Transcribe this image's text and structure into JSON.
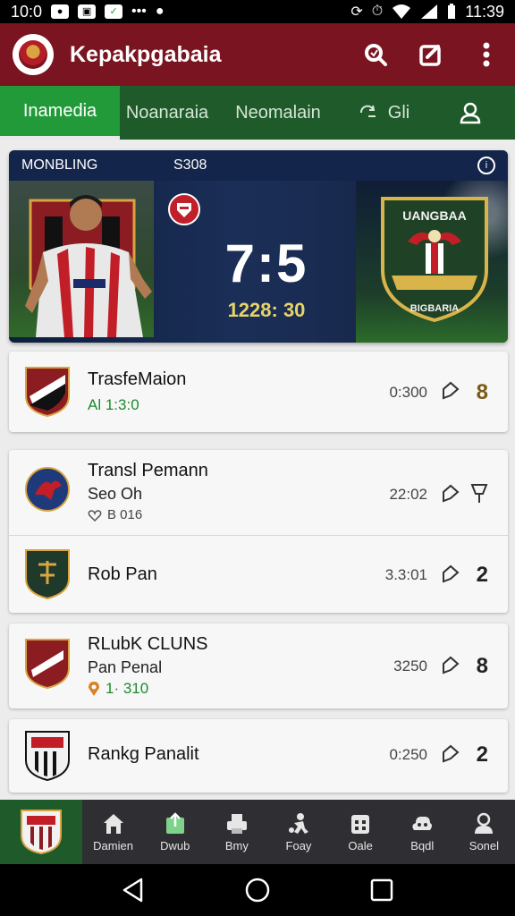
{
  "status_bar": {
    "time_left": "10:0",
    "time_right": "11:39"
  },
  "app": {
    "title": "Kepakpgabaia"
  },
  "tabs": [
    {
      "label": "Inamedia"
    },
    {
      "label": "Noanaraia"
    },
    {
      "label": "Neomalain"
    },
    {
      "label": "Gli"
    }
  ],
  "hero": {
    "league": "MONBLING",
    "round": "S308",
    "score": "7:5",
    "time": "1228: 30",
    "crest_text_top": "UANGBAA",
    "crest_text_bottom": "BIGBARIA"
  },
  "matches": [
    {
      "title": "TrasfeMaion",
      "meta": "Al 1:3:0",
      "time": "0:300",
      "count": "8"
    },
    {
      "title": "Transl Pemann",
      "sub": "Seo Oh",
      "meta": "B 016",
      "time": "22:02"
    },
    {
      "title": "Rob Pan",
      "time": "3.3:01",
      "count": "2"
    },
    {
      "title": "RLubK CLUNS",
      "sub": "Pan Penal",
      "meta": "1· 310",
      "time": "3250",
      "count": "8"
    },
    {
      "title": "Rankg Panalit",
      "time": "0:250",
      "count": "2"
    }
  ],
  "bottom_nav": [
    {
      "label": "Damien",
      "icon": "home-icon"
    },
    {
      "label": "Dwub",
      "icon": "upload-icon"
    },
    {
      "label": "Bmy",
      "icon": "print-icon"
    },
    {
      "label": "Foay",
      "icon": "person-kick-icon"
    },
    {
      "label": "Oale",
      "icon": "calendar-icon"
    },
    {
      "label": "Bqdl",
      "icon": "cloud-icon"
    },
    {
      "label": "Sonel",
      "icon": "profile-icon"
    }
  ],
  "colors": {
    "app_bar": "#7a1420",
    "tabs": "#1f5a2a",
    "active_tab": "#239a3a",
    "accent_green": "#1e8a2e"
  }
}
